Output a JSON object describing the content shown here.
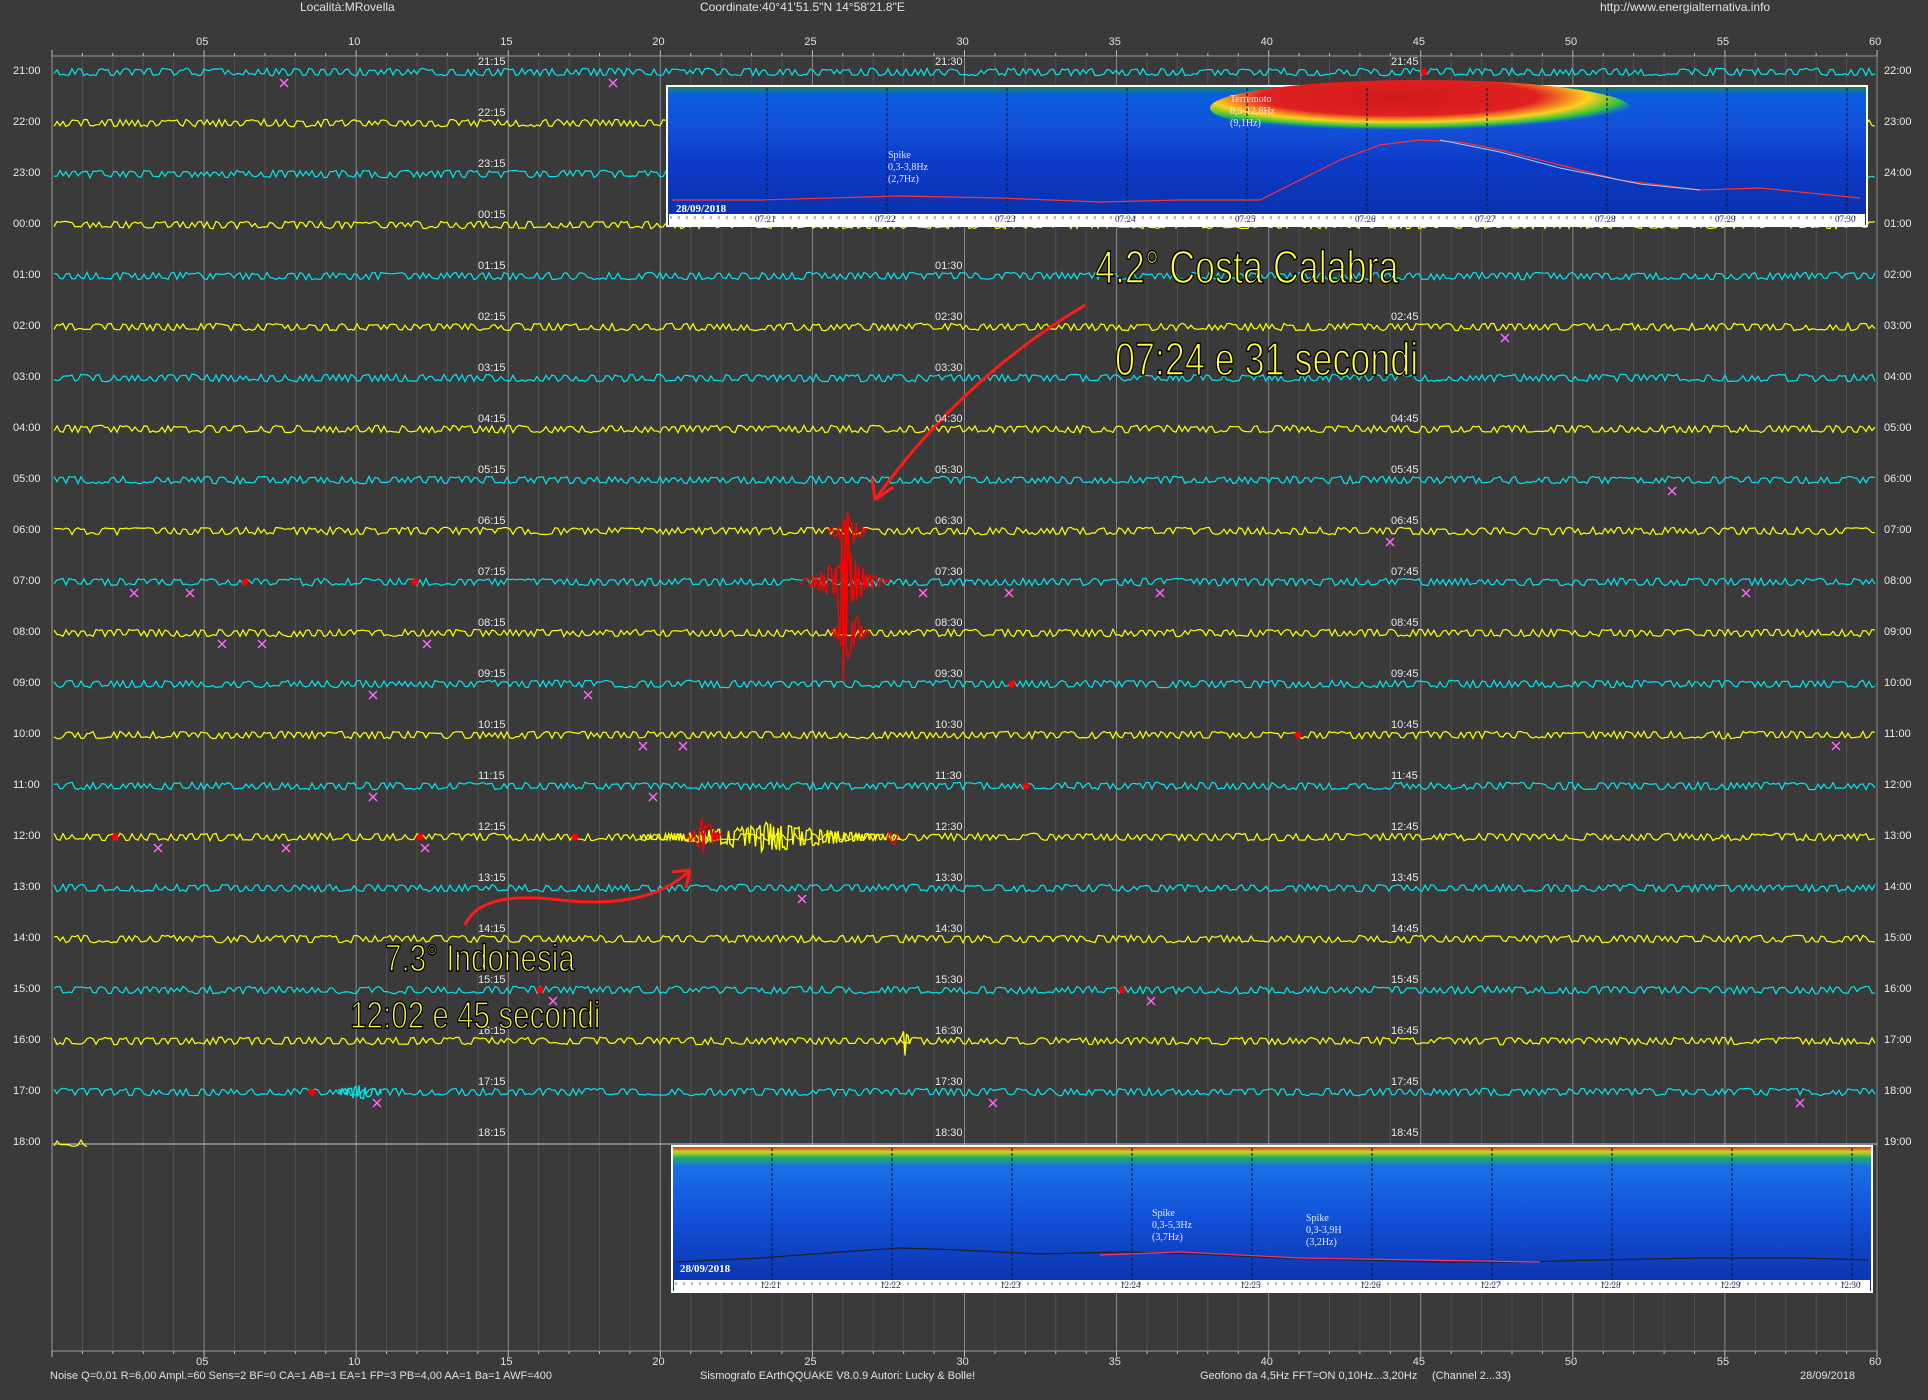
{
  "header": {
    "location": "Località:MRovella",
    "coordinates": "Coordinate:40°41'51.5\"N 14°58'21.8\"E",
    "website": "http://www.energialternativa.info"
  },
  "minute_ticks": [
    "05",
    "10",
    "15",
    "20",
    "25",
    "30",
    "35",
    "40",
    "45",
    "50",
    "55",
    "60"
  ],
  "traces": [
    {
      "left": "21:00",
      "right": "22:00",
      "mark": "21:15",
      "mark2": "21:30",
      "mark3": "21:45",
      "color": "cyan"
    },
    {
      "left": "22:00",
      "right": "23:00",
      "mark": "22:15",
      "mark2": "",
      "mark3": "",
      "color": "yellow"
    },
    {
      "left": "23:00",
      "right": "24:00",
      "mark": "23:15",
      "mark2": "",
      "mark3": "",
      "color": "cyan"
    },
    {
      "left": "00:00",
      "right": "01:00",
      "mark": "00:15",
      "mark2": "",
      "mark3": "",
      "color": "yellow"
    },
    {
      "left": "01:00",
      "right": "02:00",
      "mark": "01:15",
      "mark2": "01:30",
      "mark3": "",
      "color": "cyan"
    },
    {
      "left": "02:00",
      "right": "03:00",
      "mark": "02:15",
      "mark2": "02:30",
      "mark3": "02:45",
      "color": "yellow"
    },
    {
      "left": "03:00",
      "right": "04:00",
      "mark": "03:15",
      "mark2": "03:30",
      "mark3": "",
      "color": "cyan"
    },
    {
      "left": "04:00",
      "right": "05:00",
      "mark": "04:15",
      "mark2": "04:30",
      "mark3": "04:45",
      "color": "yellow"
    },
    {
      "left": "05:00",
      "right": "06:00",
      "mark": "05:15",
      "mark2": "05:30",
      "mark3": "05:45",
      "color": "cyan"
    },
    {
      "left": "06:00",
      "right": "07:00",
      "mark": "06:15",
      "mark2": "06:30",
      "mark3": "06:45",
      "color": "yellow"
    },
    {
      "left": "07:00",
      "right": "08:00",
      "mark": "07:15",
      "mark2": "07:30",
      "mark3": "07:45",
      "color": "cyan"
    },
    {
      "left": "08:00",
      "right": "09:00",
      "mark": "08:15",
      "mark2": "08:30",
      "mark3": "08:45",
      "color": "yellow"
    },
    {
      "left": "09:00",
      "right": "10:00",
      "mark": "09:15",
      "mark2": "09:30",
      "mark3": "09:45",
      "color": "cyan"
    },
    {
      "left": "10:00",
      "right": "11:00",
      "mark": "10:15",
      "mark2": "10:30",
      "mark3": "10:45",
      "color": "yellow"
    },
    {
      "left": "11:00",
      "right": "12:00",
      "mark": "11:15",
      "mark2": "11:30",
      "mark3": "11:45",
      "color": "cyan"
    },
    {
      "left": "12:00",
      "right": "13:00",
      "mark": "12:15",
      "mark2": "12:30",
      "mark3": "12:45",
      "color": "yellow"
    },
    {
      "left": "13:00",
      "right": "14:00",
      "mark": "13:15",
      "mark2": "13:30",
      "mark3": "13:45",
      "color": "cyan"
    },
    {
      "left": "14:00",
      "right": "15:00",
      "mark": "14:15",
      "mark2": "14:30",
      "mark3": "14:45",
      "color": "yellow"
    },
    {
      "left": "15:00",
      "right": "16:00",
      "mark": "15:15",
      "mark2": "15:30",
      "mark3": "15:45",
      "color": "cyan"
    },
    {
      "left": "16:00",
      "right": "17:00",
      "mark": "16:15",
      "mark2": "16:30",
      "mark3": "16:45",
      "color": "yellow"
    },
    {
      "left": "17:00",
      "right": "18:00",
      "mark": "17:15",
      "mark2": "17:30",
      "mark3": "17:45",
      "color": "cyan"
    },
    {
      "left": "18:00",
      "right": "19:00",
      "mark": "18:15",
      "mark2": "18:30",
      "mark3": "18:45",
      "color": "yellow"
    }
  ],
  "annotations": {
    "quake1_magnitude": "4.2°  Costa Calabra",
    "quake1_time": "07:24 e 31 secondi",
    "quake2_magnitude": "7.3° Indonesia",
    "quake2_time": "12:02 e 45 secondi"
  },
  "spectrogram_top": {
    "date": "28/09/2018",
    "event_label": [
      "Terremoto",
      "0,3-12,8Hz",
      "(9,1Hz)"
    ],
    "spike_label": [
      "Spike",
      "0,3-3,8Hz",
      "(2,7Hz)"
    ],
    "times": [
      "07:21",
      "07:22",
      "07:23",
      "07:24",
      "07:25",
      "07:26",
      "07:27",
      "07:28",
      "07:29",
      "07:30"
    ]
  },
  "spectrogram_bottom": {
    "date": "28/09/2018",
    "spike1_label": [
      "Spike",
      "0,3-5,3Hz",
      "(3,7Hz)"
    ],
    "spike2_label": [
      "Spike",
      "0,3-3,9H",
      "(3,2Hz)"
    ],
    "times": [
      "12:21",
      "12:22",
      "12:23",
      "12:24",
      "12:25",
      "12:26",
      "12:27",
      "12:28",
      "12:29",
      "12:30"
    ]
  },
  "footer": {
    "params": "Noise Q=0,01 R=6,00 Ampl.=60 Sens=2 BF=0 CA=1 AB=1 EA=1 FP=3 PB=4,00 AA=1 Ba=1 AWF=400",
    "software": "Sismografo EArthQQUAKE  V8.0.9  Autori: Lucky & Bolle!",
    "sensor": "Geofono da 4,5Hz FFT=ON 0,10Hz...3,20Hz",
    "channel": "(Channel 2...33)",
    "date": "28/09/2018"
  },
  "colors": {
    "background": "#3a3a3a",
    "cyan_trace": "#00e5ee",
    "yellow_trace": "#ffff00",
    "event": "#ff0000",
    "marker": "#ff66ff"
  }
}
